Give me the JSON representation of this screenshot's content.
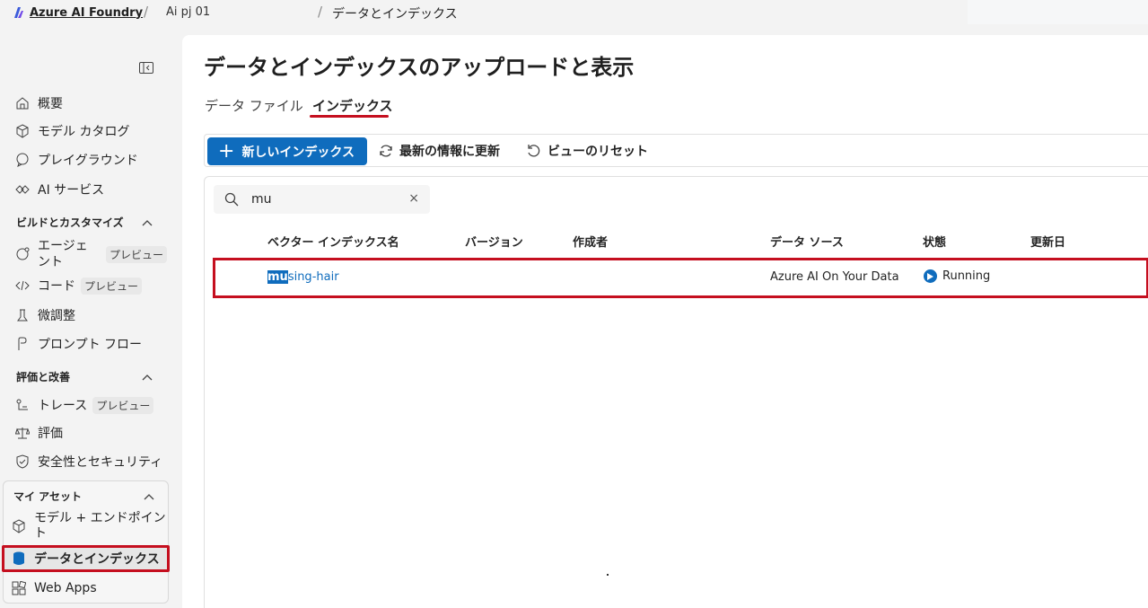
{
  "topbar": {
    "brand": "Azure AI Foundry",
    "project": "Ai pj 01",
    "current": "データとインデックス",
    "separator": "/"
  },
  "sidebar": {
    "items_top": [
      {
        "label": "概要",
        "icon": "home-icon"
      },
      {
        "label": "モデル カタログ",
        "icon": "cube-icon"
      },
      {
        "label": "プレイグラウンド",
        "icon": "chat-icon"
      },
      {
        "label": "AI サービス",
        "icon": "link-icon"
      }
    ],
    "section_build": "ビルドとカスタマイズ",
    "items_build": [
      {
        "label": "エージェント",
        "label_line1": "エージェ",
        "label_line2": "ント",
        "badge": "プレビュー",
        "icon": "agent-icon"
      },
      {
        "label": "コード",
        "badge": "プレビュー",
        "icon": "code-icon"
      },
      {
        "label": "微調整",
        "icon": "flask-icon"
      },
      {
        "label": "プロンプト フロー",
        "icon": "flow-icon"
      }
    ],
    "section_eval": "評価と改善",
    "items_eval": [
      {
        "label": "トレース",
        "badge": "プレビュー",
        "icon": "trace-icon"
      },
      {
        "label": "評価",
        "icon": "scale-icon"
      },
      {
        "label": "安全性とセキュリティ",
        "icon": "shield-icon"
      }
    ],
    "section_assets": "マイ アセット",
    "items_assets": [
      {
        "label": "モデル + エンドポイント",
        "label_line1": "モデル + エンドポイン",
        "label_line2": "ト",
        "icon": "box-icon"
      },
      {
        "label": "データとインデックス",
        "icon": "database-icon",
        "active": true
      },
      {
        "label": "Web Apps",
        "icon": "apps-icon"
      }
    ]
  },
  "main": {
    "title": "データとインデックスのアップロードと表示",
    "tabs": [
      {
        "label": "データ ファイル",
        "active": false
      },
      {
        "label": "インデックス",
        "active": true
      }
    ],
    "toolbar": {
      "new_index": "新しいインデックス",
      "refresh": "最新の情報に更新",
      "reset_view": "ビューのリセット"
    },
    "search": {
      "value": "mu",
      "clear": "×"
    },
    "table": {
      "columns": [
        "ベクター インデックス名",
        "バージョン",
        "作成者",
        "データ ソース",
        "状態",
        "更新日"
      ],
      "rows": [
        {
          "name_match": "mu",
          "name_rest": "sing-hair",
          "version": "",
          "creator": "",
          "data_source": "Azure AI On Your Data",
          "status": "Running",
          "updated": ""
        }
      ]
    }
  },
  "colors": {
    "accent": "#0f6cbd",
    "highlight_border": "#c50f1f"
  }
}
